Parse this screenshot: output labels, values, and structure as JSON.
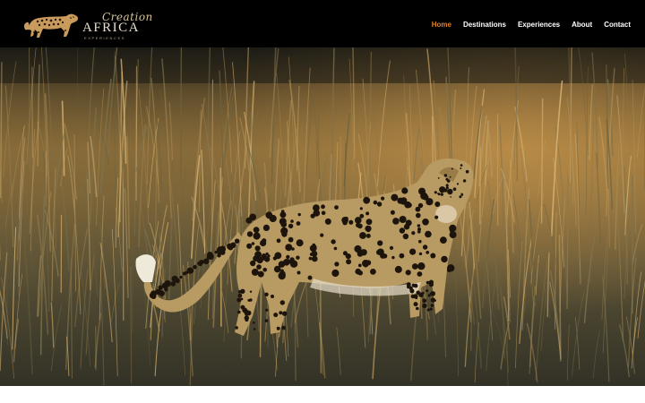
{
  "brand": {
    "script": "Creation",
    "name": "AFRICA",
    "tagline": "EXPERIENCES"
  },
  "nav": {
    "items": [
      {
        "label": "Home",
        "active": true
      },
      {
        "label": "Destinations",
        "active": false
      },
      {
        "label": "Experiences",
        "active": false
      },
      {
        "label": "About",
        "active": false
      },
      {
        "label": "Contact",
        "active": false
      }
    ]
  },
  "hero": {
    "image": "leopard-in-grassland",
    "accent": "#d9822b"
  },
  "colors": {
    "header_bg": "#000000",
    "nav_text": "#ffffff",
    "nav_active": "#d9822b"
  }
}
